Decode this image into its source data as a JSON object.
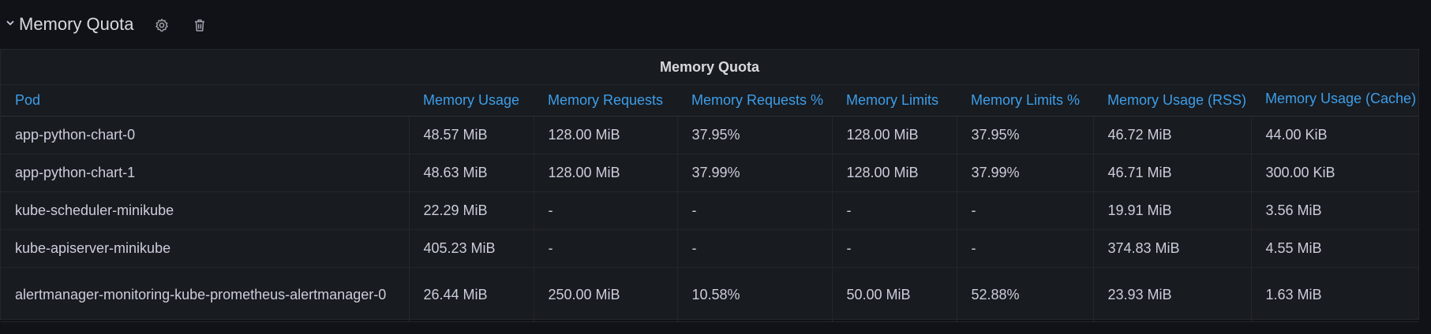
{
  "row": {
    "title": "Memory Quota",
    "icons": [
      "chevron-down-icon",
      "gear-icon",
      "trash-icon"
    ]
  },
  "panel": {
    "title": "Memory Quota",
    "columns": [
      "Pod",
      "Memory Usage",
      "Memory Requests",
      "Memory Requests %",
      "Memory Limits",
      "Memory Limits %",
      "Memory Usage (RSS)",
      "Memory Usage (Cache)"
    ],
    "rows": [
      [
        "app-python-chart-0",
        "48.57 MiB",
        "128.00 MiB",
        "37.95%",
        "128.00 MiB",
        "37.95%",
        "46.72 MiB",
        "44.00 KiB"
      ],
      [
        "app-python-chart-1",
        "48.63 MiB",
        "128.00 MiB",
        "37.99%",
        "128.00 MiB",
        "37.99%",
        "46.71 MiB",
        "300.00 KiB"
      ],
      [
        "kube-scheduler-minikube",
        "22.29 MiB",
        "-",
        "-",
        "-",
        "-",
        "19.91 MiB",
        "3.56 MiB"
      ],
      [
        "kube-apiserver-minikube",
        "405.23 MiB",
        "-",
        "-",
        "-",
        "-",
        "374.83 MiB",
        "4.55 MiB"
      ],
      [
        "alertmanager-monitoring-kube-prometheus-alertmanager-0",
        "26.44 MiB",
        "250.00 MiB",
        "10.58%",
        "50.00 MiB",
        "52.88%",
        "23.93 MiB",
        "1.63 MiB"
      ]
    ]
  },
  "colors": {
    "background": "#111217",
    "panel": "#181b1f",
    "header_link": "#3d9eea",
    "text": "#ccccdc"
  }
}
